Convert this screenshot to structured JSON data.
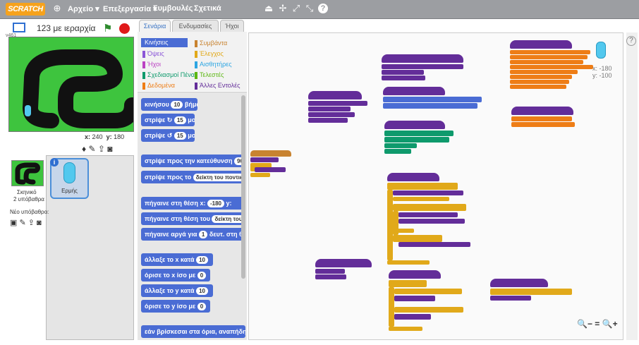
{
  "menubar": {
    "logo": "SCRATCH",
    "file": "Αρχείο ▾",
    "edit": "Επεξεργασία ▾",
    "tips": "Συμβουλές",
    "about": "Σχετικά"
  },
  "stage": {
    "title": "123 με ιεραρχία",
    "version": "v461",
    "x_label": "x:",
    "x_value": "240",
    "y_label": "y:",
    "y_value": "180"
  },
  "sprites": {
    "stage_label": "Σκηνικό",
    "stage_backdrops": "2 υπόβαθρα",
    "new_backdrop": "Νέο υπόβαθρο:",
    "sprite_name": "Ερμής"
  },
  "tabs": {
    "scripts": "Σενάρια",
    "costumes": "Ενδυμασίες",
    "sounds": "Ήχοι"
  },
  "categories": [
    {
      "label": "Κινήσεις",
      "color": "#4a6cd4"
    },
    {
      "label": "Συμβάντα",
      "color": "#c88330"
    },
    {
      "label": "Όψεις",
      "color": "#8a55d7"
    },
    {
      "label": "Έλεγχος",
      "color": "#e1a91a"
    },
    {
      "label": "Ήχοι",
      "color": "#bb42c3"
    },
    {
      "label": "Αισθητήρες",
      "color": "#2ca5e2"
    },
    {
      "label": "Σχεδιασμοί Πένα",
      "color": "#0e9a6c"
    },
    {
      "label": "Τελεστές",
      "color": "#5cb712"
    },
    {
      "label": "Δεδομένα",
      "color": "#ee7d16"
    },
    {
      "label": "Άλλες Εντολές",
      "color": "#632d99"
    }
  ],
  "palette": {
    "move": "κινήσου",
    "move_val": "10",
    "move_unit": "βήματα",
    "turn_right": "στρίψε",
    "turn_right_val": "15",
    "turn_right_unit": "μοίρες",
    "turn_left": "στρίψε",
    "turn_left_val": "15",
    "turn_left_unit": "μοίρες",
    "point_dir": "στρίψε προς την κατεύθυνση",
    "point_dir_val": "90",
    "point_towards": "στρίψε προς το",
    "point_towards_val": "δείκτη του ποντικιού",
    "goto_xy": "πήγαινε στη θέση x:",
    "goto_x_val": "-180",
    "goto_y_label": "y:",
    "goto": "πήγαινε στη θέση του",
    "goto_val": "δείκτη του ποντικιού",
    "glide": "πήγαινε αργά για",
    "glide_val": "1",
    "glide_rest": "δευτ. στη θέση x:",
    "change_x": "άλλαξε το x κατά",
    "change_x_val": "10",
    "set_x": "όρισε το x ίσο με",
    "set_x_val": "0",
    "change_y": "άλλαξε το y κατά",
    "change_y_val": "10",
    "set_y": "όρισε το y ίσο με",
    "set_y_val": "0",
    "bounce": "εάν βρίσκεσαι στα όρια, αναπήδησε"
  },
  "readout": {
    "x": "x: -180",
    "y": "y: -100"
  },
  "zoom": {
    "out": "🔍−",
    "reset": "=",
    "in": "🔍+"
  },
  "help": "?"
}
